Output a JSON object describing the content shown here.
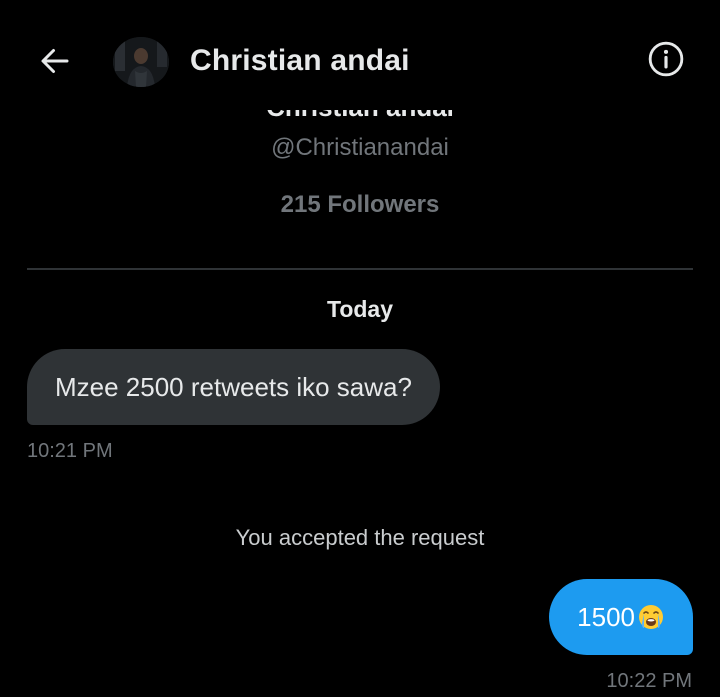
{
  "header": {
    "name": "Christian andai",
    "back_icon": "arrow-left-icon",
    "info_icon": "info-circle-icon"
  },
  "profile": {
    "name": "Christian andai",
    "handle": "@Christianandai",
    "followers": "215 Followers"
  },
  "conversation": {
    "date_separator": "Today",
    "messages": [
      {
        "direction": "received",
        "text": "Mzee 2500 retweets iko sawa?",
        "time": "10:21 PM"
      },
      {
        "direction": "sent",
        "text": "1500",
        "emoji": "loudly-crying-face-icon",
        "time": "10:22 PM"
      }
    ],
    "system_message": "You accepted the request"
  },
  "colors": {
    "background": "#000000",
    "received_bubble": "#2f3336",
    "sent_bubble": "#1d9bf0",
    "secondary_text": "#71767b",
    "primary_text": "#e7e9ea"
  }
}
